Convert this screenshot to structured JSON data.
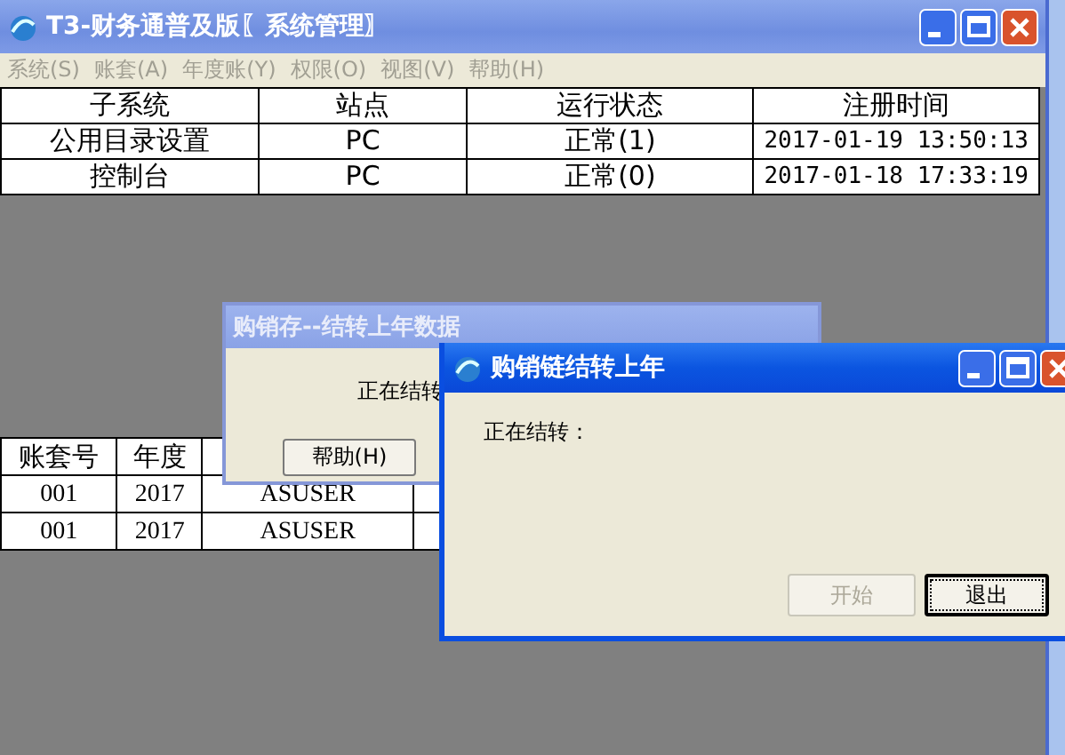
{
  "main_window": {
    "title": "T3-财务通普及版〖系统管理〗",
    "menu": [
      {
        "label": "系统(S)",
        "disabled": true
      },
      {
        "label": "账套(A)",
        "disabled": true
      },
      {
        "label": "年度账(Y)",
        "disabled": true
      },
      {
        "label": "权限(O)",
        "disabled": true
      },
      {
        "label": "视图(V)",
        "disabled": true
      },
      {
        "label": "帮助(H)",
        "disabled": true
      }
    ],
    "sessions_table": {
      "columns": [
        "子系统",
        "站点",
        "运行状态",
        "注册时间"
      ],
      "rows": [
        [
          "公用目录设置",
          "PC",
          "正常(1)",
          "2017-01-19 13:50:13"
        ],
        [
          "控制台",
          "PC",
          "正常(0)",
          "2017-01-18 17:33:19"
        ]
      ]
    },
    "accounts_table": {
      "columns": [
        "账套号",
        "年度"
      ],
      "rows": [
        [
          "001",
          "2017",
          "ASUSER"
        ],
        [
          "001",
          "2017",
          "ASUSER"
        ]
      ]
    }
  },
  "dialogs": [
    {
      "title": "购销存--结转上年数据",
      "active": false,
      "message": "正在结转",
      "buttons": [
        {
          "label": "帮助(H)",
          "disabled": false,
          "focused": false
        }
      ]
    },
    {
      "title": "购销链结转上年",
      "active": true,
      "message": "正在结转：",
      "buttons": [
        {
          "label": "开始",
          "disabled": true,
          "focused": false
        },
        {
          "label": "退出",
          "disabled": false,
          "focused": true
        }
      ]
    }
  ]
}
